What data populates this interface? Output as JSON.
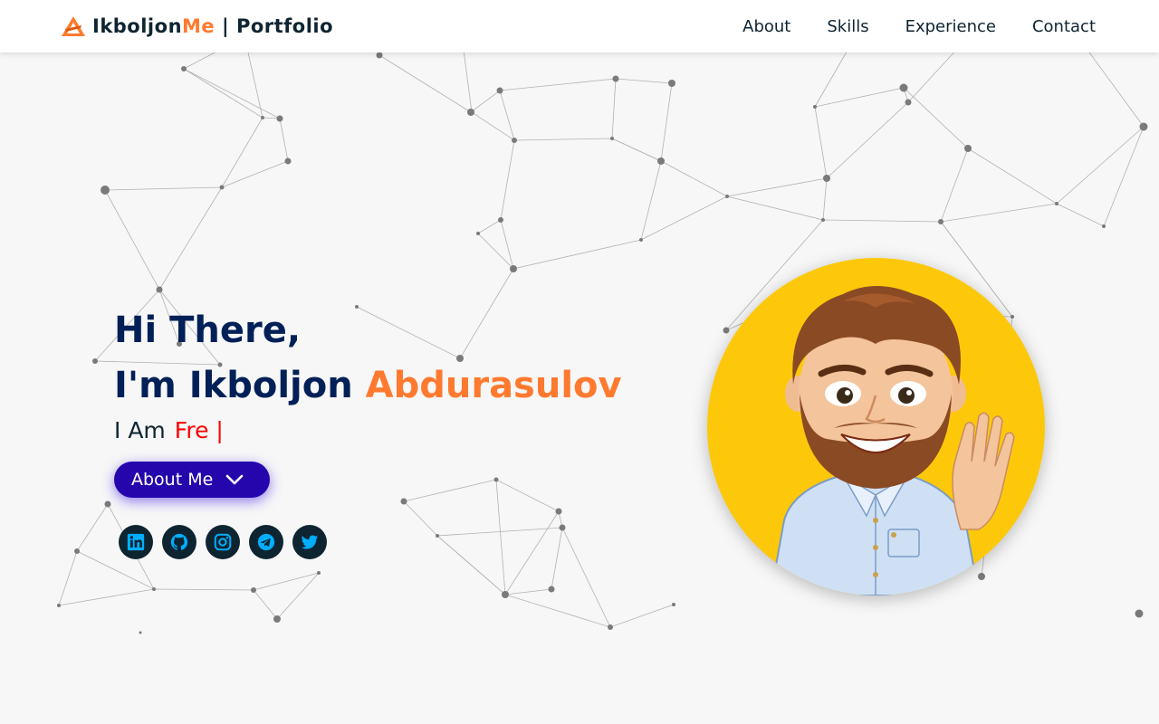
{
  "header": {
    "brand_first": "Ikboljon",
    "brand_accent": "Me",
    "brand_rest": " | Portfolio",
    "nav": [
      "About",
      "Skills",
      "Experience",
      "Contact"
    ]
  },
  "hero": {
    "greeting": "Hi There,",
    "intro": "I'm Ikboljon ",
    "last_name": "Abdurasulov",
    "i_am": "I Am",
    "typed_text": "Fre |",
    "about_button": "About Me"
  },
  "socials": [
    "linkedin-icon",
    "github-icon",
    "instagram-icon",
    "telegram-icon",
    "twitter-icon"
  ],
  "colors": {
    "header_bg": "#ffffff",
    "page_bg": "#f7f7f7",
    "heading_navy": "#002057",
    "accent_orange": "#ff7a2f",
    "typed_red": "#ff0000",
    "button_purple": "#2506ad",
    "social_icon": "#00aeff",
    "avatar_bg": "#fdc80a"
  }
}
